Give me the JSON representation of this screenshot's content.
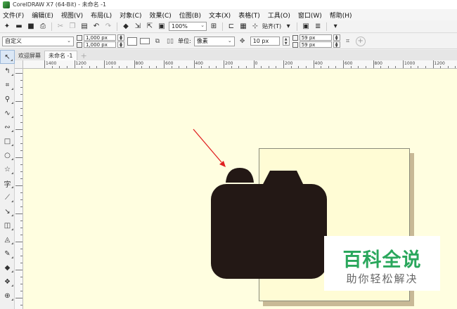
{
  "window": {
    "title": "CorelDRAW X7 (64-Bit) - 未命名 -1"
  },
  "menu": [
    "文件(F)",
    "编辑(E)",
    "视图(V)",
    "布局(L)",
    "对象(C)",
    "效果(C)",
    "位图(B)",
    "文本(X)",
    "表格(T)",
    "工具(O)",
    "窗口(W)",
    "帮助(H)"
  ],
  "toolbar": {
    "zoom_value": "100%",
    "snap_label": "贴齐(T)"
  },
  "property_bar": {
    "preset": "自定义",
    "width": "1,000 px",
    "height": "1,000 px",
    "units_label": "单位:",
    "units_value": "像素",
    "nudge": "10 px",
    "dup_x": "59 px",
    "dup_y": "59 px"
  },
  "tabs": [
    {
      "label": "欢迎屏幕"
    },
    {
      "label": "未命名 -1"
    }
  ],
  "ruler": {
    "labels": [
      "1400",
      "1200",
      "1000",
      "800",
      "600",
      "400",
      "200",
      "0",
      "200",
      "400",
      "600",
      "800",
      "1000",
      "1200"
    ]
  },
  "watermark": {
    "title": "百科全说",
    "subtitle": "助你轻松解决"
  },
  "colors": {
    "canvas_bg": "#fffee0",
    "page_fill": "#fffcd5",
    "camera_fill": "#231815",
    "arrow": "#e02020",
    "watermark_green": "#2aa75c"
  }
}
